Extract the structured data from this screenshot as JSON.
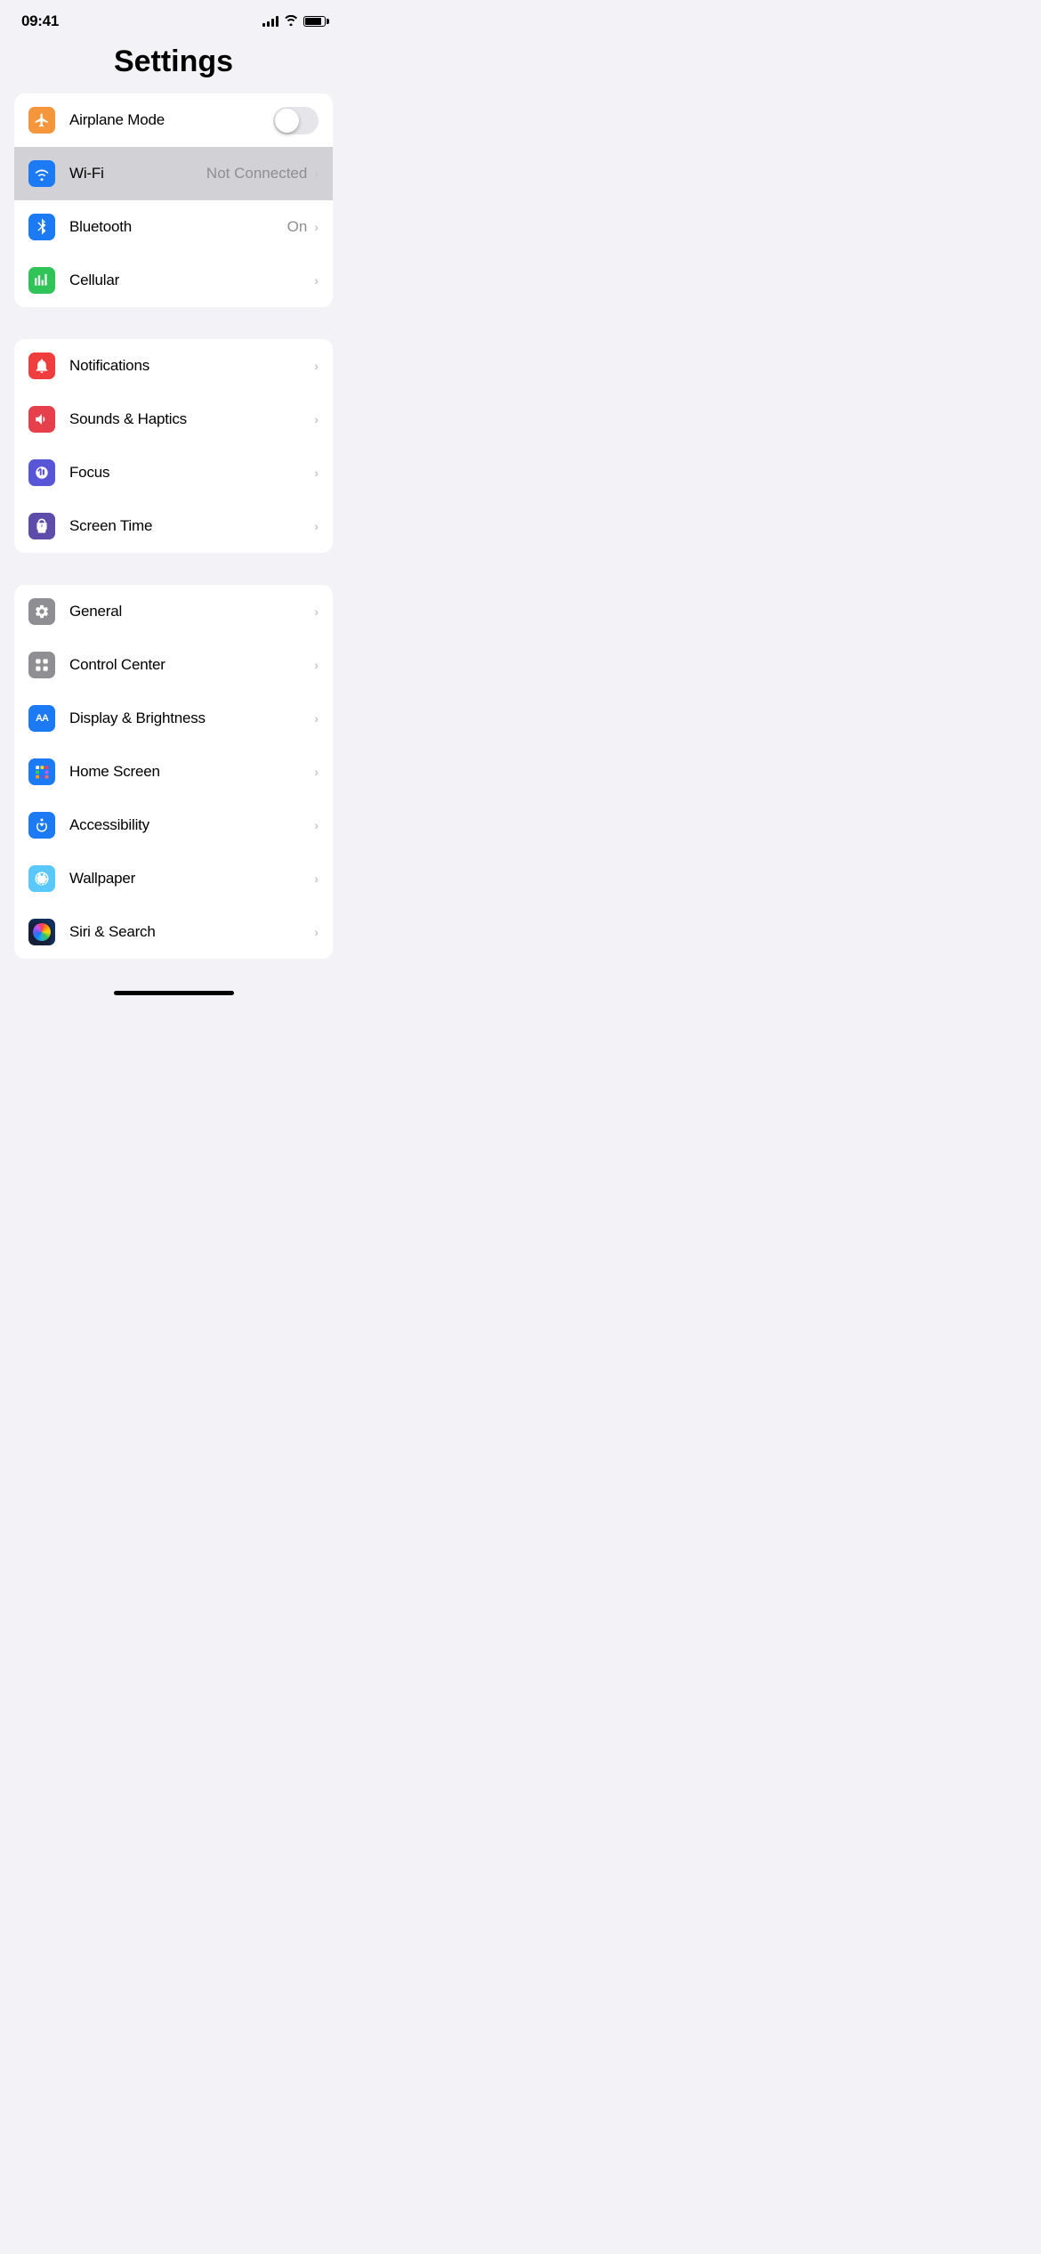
{
  "statusBar": {
    "time": "09:41"
  },
  "pageTitle": "Settings",
  "groups": [
    {
      "id": "connectivity",
      "rows": [
        {
          "id": "airplane-mode",
          "label": "Airplane Mode",
          "iconColor": "icon-orange",
          "iconType": "airplane",
          "hasToggle": true,
          "toggleOn": false,
          "hasChevron": false,
          "value": ""
        },
        {
          "id": "wifi",
          "label": "Wi-Fi",
          "iconColor": "icon-blue",
          "iconType": "wifi",
          "hasToggle": false,
          "hasChevron": true,
          "value": "Not Connected",
          "highlighted": true
        },
        {
          "id": "bluetooth",
          "label": "Bluetooth",
          "iconColor": "icon-blue",
          "iconType": "bluetooth",
          "hasToggle": false,
          "hasChevron": true,
          "value": "On"
        },
        {
          "id": "cellular",
          "label": "Cellular",
          "iconColor": "icon-green",
          "iconType": "cellular",
          "hasToggle": false,
          "hasChevron": true,
          "value": ""
        }
      ]
    },
    {
      "id": "notifications",
      "rows": [
        {
          "id": "notifications",
          "label": "Notifications",
          "iconColor": "icon-red",
          "iconType": "bell",
          "hasToggle": false,
          "hasChevron": true,
          "value": ""
        },
        {
          "id": "sounds",
          "label": "Sounds & Haptics",
          "iconColor": "icon-red",
          "iconType": "sound",
          "hasToggle": false,
          "hasChevron": true,
          "value": ""
        },
        {
          "id": "focus",
          "label": "Focus",
          "iconColor": "icon-indigo",
          "iconType": "moon",
          "hasToggle": false,
          "hasChevron": true,
          "value": ""
        },
        {
          "id": "screen-time",
          "label": "Screen Time",
          "iconColor": "icon-purple",
          "iconType": "hourglass",
          "hasToggle": false,
          "hasChevron": true,
          "value": ""
        }
      ]
    },
    {
      "id": "display",
      "rows": [
        {
          "id": "general",
          "label": "General",
          "iconColor": "icon-gray",
          "iconType": "gear",
          "hasToggle": false,
          "hasChevron": true,
          "value": ""
        },
        {
          "id": "control-center",
          "label": "Control Center",
          "iconColor": "icon-gray",
          "iconType": "sliders",
          "hasToggle": false,
          "hasChevron": true,
          "value": ""
        },
        {
          "id": "display-brightness",
          "label": "Display & Brightness",
          "iconColor": "icon-blue2",
          "iconType": "aa",
          "hasToggle": false,
          "hasChevron": true,
          "value": ""
        },
        {
          "id": "home-screen",
          "label": "Home Screen",
          "iconColor": "icon-blue2",
          "iconType": "homescreen",
          "hasToggle": false,
          "hasChevron": true,
          "value": ""
        },
        {
          "id": "accessibility",
          "label": "Accessibility",
          "iconColor": "icon-blue2",
          "iconType": "accessibility",
          "hasToggle": false,
          "hasChevron": true,
          "value": ""
        },
        {
          "id": "wallpaper",
          "label": "Wallpaper",
          "iconColor": "icon-teal",
          "iconType": "flower",
          "hasToggle": false,
          "hasChevron": true,
          "value": ""
        },
        {
          "id": "siri",
          "label": "Siri & Search",
          "iconColor": "icon-siri",
          "iconType": "siri",
          "hasToggle": false,
          "hasChevron": true,
          "value": ""
        }
      ]
    }
  ]
}
